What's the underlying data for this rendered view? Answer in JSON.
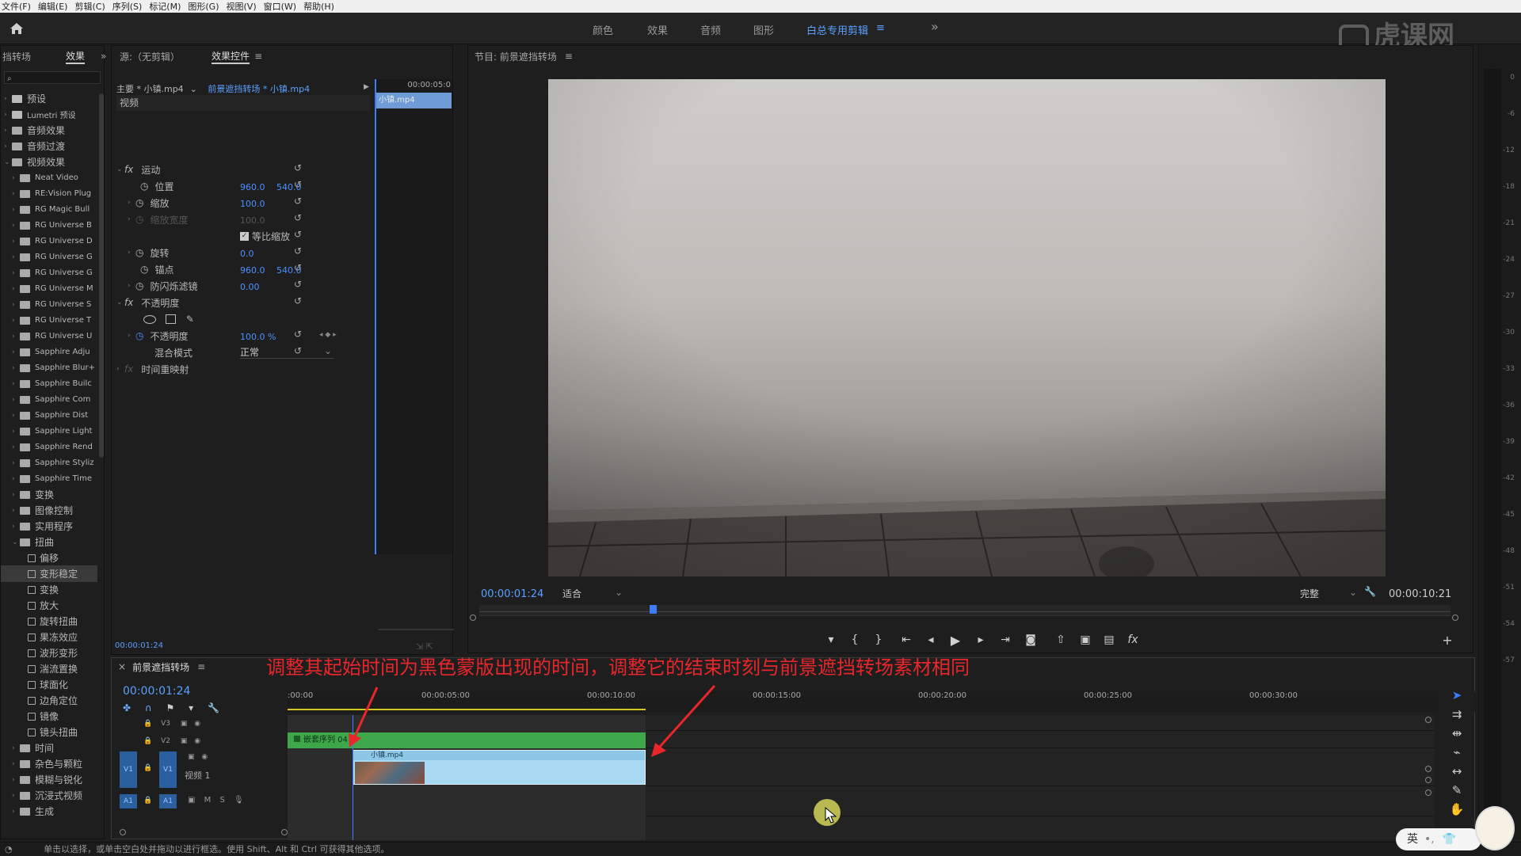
{
  "menu": [
    "文件(F)",
    "编辑(E)",
    "剪辑(C)",
    "序列(S)",
    "标记(M)",
    "图形(G)",
    "视图(V)",
    "窗口(W)",
    "帮助(H)"
  ],
  "workspaces": [
    "颜色",
    "效果",
    "音频",
    "图形",
    "白总专用剪辑"
  ],
  "workspace_more": "»",
  "watermark": "虎课网",
  "effects_panel": {
    "tab1": "挡转场",
    "tab2": "效果",
    "more": "»",
    "items": [
      {
        "label": "预设",
        "level": 0,
        "type": "star"
      },
      {
        "label": "Lumetri 预设",
        "level": 0,
        "type": "star"
      },
      {
        "label": "音频效果",
        "level": 0,
        "type": "folder"
      },
      {
        "label": "音频过渡",
        "level": 0,
        "type": "folder"
      },
      {
        "label": "视频效果",
        "level": 0,
        "type": "folder"
      },
      {
        "label": "Neat Video",
        "level": 1,
        "type": "folder"
      },
      {
        "label": "RE:Vision Plug",
        "level": 1,
        "type": "folder"
      },
      {
        "label": "RG Magic Bull",
        "level": 1,
        "type": "folder"
      },
      {
        "label": "RG Universe B",
        "level": 1,
        "type": "folder"
      },
      {
        "label": "RG Universe D",
        "level": 1,
        "type": "folder"
      },
      {
        "label": "RG Universe G",
        "level": 1,
        "type": "folder"
      },
      {
        "label": "RG Universe G",
        "level": 1,
        "type": "folder"
      },
      {
        "label": "RG Universe M",
        "level": 1,
        "type": "folder"
      },
      {
        "label": "RG Universe S",
        "level": 1,
        "type": "folder"
      },
      {
        "label": "RG Universe T",
        "level": 1,
        "type": "folder"
      },
      {
        "label": "RG Universe U",
        "level": 1,
        "type": "folder"
      },
      {
        "label": "Sapphire Adju",
        "level": 1,
        "type": "folder"
      },
      {
        "label": "Sapphire Blur+",
        "level": 1,
        "type": "folder"
      },
      {
        "label": "Sapphire Builc",
        "level": 1,
        "type": "folder"
      },
      {
        "label": "Sapphire Com",
        "level": 1,
        "type": "folder"
      },
      {
        "label": "Sapphire Dist",
        "level": 1,
        "type": "folder"
      },
      {
        "label": "Sapphire Light",
        "level": 1,
        "type": "folder"
      },
      {
        "label": "Sapphire Rend",
        "level": 1,
        "type": "folder"
      },
      {
        "label": "Sapphire Styliz",
        "level": 1,
        "type": "folder"
      },
      {
        "label": "Sapphire Time",
        "level": 1,
        "type": "folder"
      },
      {
        "label": "变换",
        "level": 1,
        "type": "folder"
      },
      {
        "label": "图像控制",
        "level": 1,
        "type": "folder"
      },
      {
        "label": "实用程序",
        "level": 1,
        "type": "folder"
      },
      {
        "label": "扭曲",
        "level": 1,
        "type": "folder"
      },
      {
        "label": "偏移",
        "level": 2,
        "type": "effect"
      },
      {
        "label": "变形稳定",
        "level": 2,
        "type": "effect",
        "selected": true
      },
      {
        "label": "变换",
        "level": 2,
        "type": "effect"
      },
      {
        "label": "放大",
        "level": 2,
        "type": "effect"
      },
      {
        "label": "旋转扭曲",
        "level": 2,
        "type": "effect"
      },
      {
        "label": "果冻效应",
        "level": 2,
        "type": "effect"
      },
      {
        "label": "波形变形",
        "level": 2,
        "type": "effect"
      },
      {
        "label": "湍流置换",
        "level": 2,
        "type": "effect"
      },
      {
        "label": "球面化",
        "level": 2,
        "type": "effect"
      },
      {
        "label": "边角定位",
        "level": 2,
        "type": "effect"
      },
      {
        "label": "镜像",
        "level": 2,
        "type": "effect"
      },
      {
        "label": "镜头扭曲",
        "level": 2,
        "type": "effect"
      },
      {
        "label": "时间",
        "level": 1,
        "type": "folder"
      },
      {
        "label": "杂色与颗粒",
        "level": 1,
        "type": "folder"
      },
      {
        "label": "模糊与锐化",
        "level": 1,
        "type": "folder"
      },
      {
        "label": "沉浸式视频",
        "level": 1,
        "type": "folder"
      },
      {
        "label": "生成",
        "level": 1,
        "type": "folder"
      }
    ]
  },
  "effect_controls": {
    "tab_source": "源:（无剪辑）",
    "tab_active": "效果控件",
    "master": "主要 * 小镇.mp4",
    "sequence_clip": "前景遮挡转场 * 小镇.mp4",
    "mini_time": "00:00:05:0",
    "mini_clip": "小镇.mp4",
    "section_video": "视频",
    "motion": "运动",
    "position_label": "位置",
    "position_x": "960.0",
    "position_y": "540.0",
    "scale_label": "缩放",
    "scale_val": "100.0",
    "scale_width_label": "缩放宽度",
    "scale_width_val": "100.0",
    "uniform_label": "等比缩放",
    "rotation_label": "旋转",
    "rotation_val": "0.0",
    "anchor_label": "锚点",
    "anchor_x": "960.0",
    "anchor_y": "540.0",
    "flicker_label": "防闪烁滤镜",
    "flicker_val": "0.00",
    "opacity_group": "不透明度",
    "opacity_label": "不透明度",
    "opacity_val": "100.0 %",
    "blend_label": "混合模式",
    "blend_val": "正常",
    "timeremap_label": "时间重映射",
    "timecode": "00:00:01:24"
  },
  "program": {
    "title": "节目: 前景遮挡转场",
    "timecode": "00:00:01:24",
    "fit": "适合",
    "quality": "完整",
    "duration": "00:00:10:21"
  },
  "annotation": "调整其起始时间为黑色蒙版出现的时间，调整它的结束时刻与前景遮挡转场素材相同",
  "timeline": {
    "title": "前景遮挡转场",
    "timecode": "00:00:01:24",
    "ruler": [
      ":00:00",
      "00:00:05:00",
      "00:00:10:00",
      "00:00:15:00",
      "00:00:20:00",
      "00:00:25:00",
      "00:00:30:00"
    ],
    "tracks": {
      "v3": "V3",
      "v2": "V2",
      "v1": "V1",
      "v1name": "视频 1",
      "a1": "A1"
    },
    "nested_clip": "嵌套序列 04",
    "clip": "小镇.mp4"
  },
  "vu_ticks": [
    "0",
    "-6",
    "-12",
    "-18",
    "-21",
    "-24",
    "-27",
    "-30",
    "-33",
    "-36",
    "-39",
    "-42",
    "-45",
    "-48",
    "-51",
    "-54",
    "-57"
  ],
  "status": "单击以选择，或单击空白处并拖动以进行框选。使用 Shift、Alt 和 Ctrl 可获得其他选项。",
  "ime": "英"
}
